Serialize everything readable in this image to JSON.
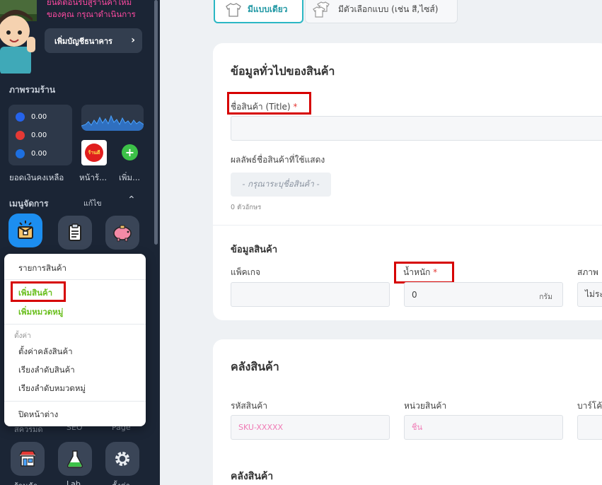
{
  "sidebar": {
    "promo_line1": "ยินดีต้อนรับสู่ร้านค้าใหม่",
    "promo_line2": "ของคุณ กรุณาดำเนินการ",
    "add_bank_button": "เพิ่มบัญชีธนาคาร",
    "overview_title": "ภาพรวมร้าน",
    "balances": [
      {
        "value": "0.00",
        "color": "#2563eb"
      },
      {
        "value": "0.00",
        "color": "#e53935"
      },
      {
        "value": "0.00",
        "color": "#1d6fe0"
      }
    ],
    "balance_caption": "ยอดเงินคงเหลือ",
    "shopfront_caption": "หน้าร้...",
    "add_caption": "เพิ่ม...",
    "logo_text": "ร้านดี",
    "menu_title": "เมนูจัดการ",
    "menu_edit": "แก้ไข",
    "bottom_captions": [
      "สควรมด",
      "SEO",
      "Page"
    ],
    "bottom_icon_captions": [
      "ร้านค้า",
      "Lab",
      "ตั้งค่า"
    ],
    "icon_names": [
      "box-icon",
      "clipboard-icon",
      "piggy-bank-icon",
      "storefront-icon",
      "flask-icon",
      "gear-icon"
    ]
  },
  "popup_menu": {
    "product_list": "รายการสินค้า",
    "add_product": "เพิ่มสินค้า",
    "add_category": "เพิ่มหมวดหมู่",
    "settings_header": "ตั้งค่า",
    "warehouse_settings": "ตั้งค่าคลังสินค้า",
    "sort_products": "เรียงลำดับสินค้า",
    "sort_categories": "เรียงลำดับหมวดหมู่",
    "close_window": "ปิดหน้าต่าง"
  },
  "variant_toggle": {
    "single": "มีแบบเดียว",
    "multi": "มีตัวเลือกแบบ (เช่น สี,ไซส์)"
  },
  "general_card": {
    "title": "ข้อมูลทั่วไปของสินค้า",
    "name_label": "ชื่อสินค้า (Title)",
    "required_mark": "*",
    "name_value": "",
    "preview_label": "ผลลัพธ์ชื่อสินค้าที่ใช้แสดง",
    "preview_placeholder": "- กรุณาระบุชื่อสินค้า -",
    "char_count": "0 ตัวอักษร",
    "product_info_title": "ข้อมูลสินค้า",
    "package_label": "แพ็คเกจ",
    "package_value": "",
    "weight_label": "น้ำหนัก",
    "weight_value": "0",
    "weight_unit": "กรัม",
    "condition_label": "สภาพ",
    "condition_value": "ไม่ระ"
  },
  "warehouse_card": {
    "title": "คลังสินค้า",
    "sku_label": "รหัสสินค้า",
    "sku_placeholder": "SKU-XXXXX",
    "unit_label": "หน่วยสินค้า",
    "unit_placeholder": "ชิ้น",
    "barcode_label": "บาร์โค้",
    "stock_title": "คลังสินค้า"
  },
  "colors": {
    "sidebar_bg": "#1b2535",
    "accent_teal": "#2bb7c4",
    "accent_green": "#6abf1e",
    "highlight_red": "#d60000",
    "promo_pink": "#ff4aa2"
  }
}
